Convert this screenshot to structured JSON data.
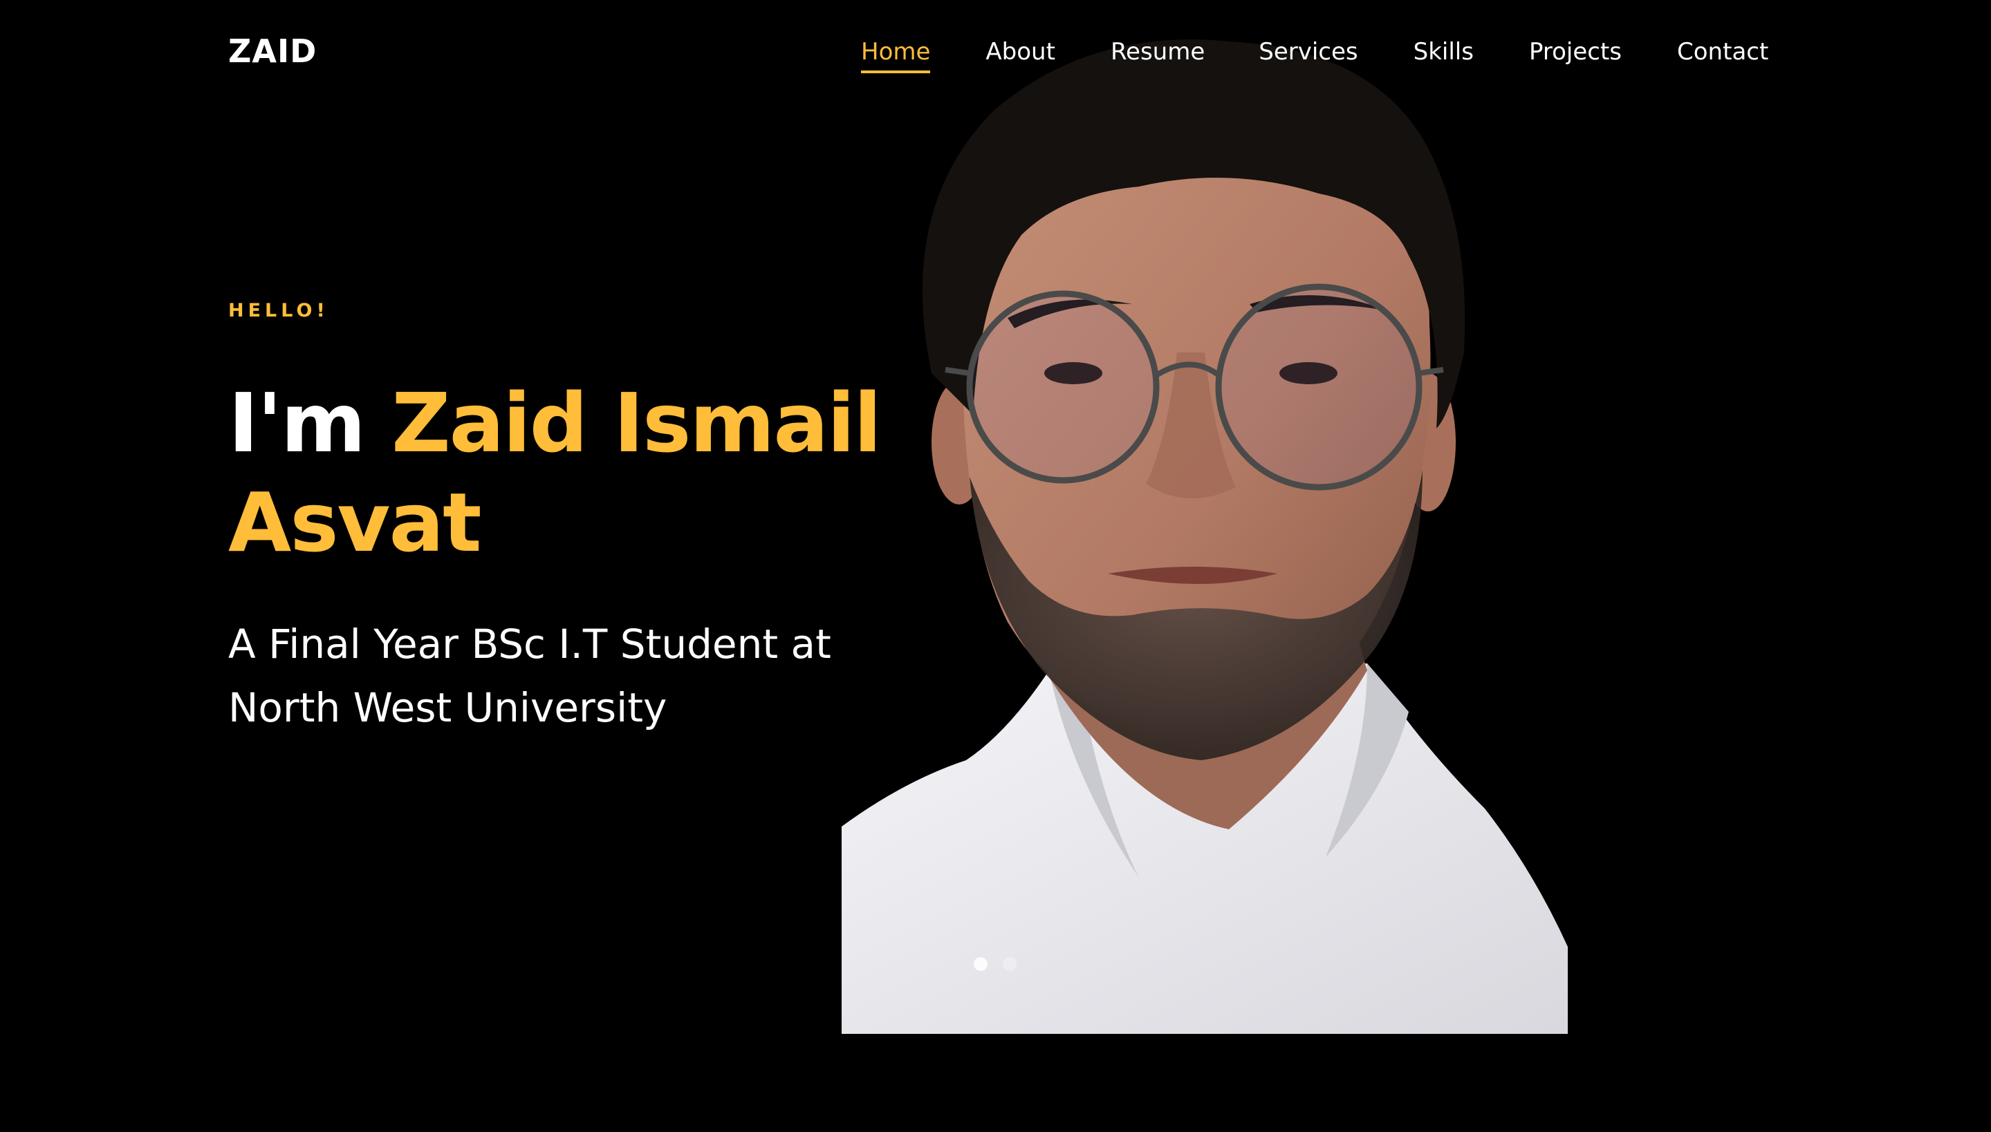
{
  "brand": "ZAID",
  "nav": {
    "items": [
      "Home",
      "About",
      "Resume",
      "Services",
      "Skills",
      "Projects",
      "Contact"
    ],
    "active_index": 0
  },
  "hero": {
    "subheading": "HELLO!",
    "greeting": "I'm",
    "name": "Zaid Ismail Asvat",
    "tagline": "A Final Year BSc I.T Student at North West University"
  },
  "slider": {
    "total": 2,
    "current": 1
  },
  "colors": {
    "background": "#000000",
    "accent": "#ffbd39",
    "text": "#ffffff"
  },
  "icons": {
    "portrait": "person-portrait-photo"
  }
}
